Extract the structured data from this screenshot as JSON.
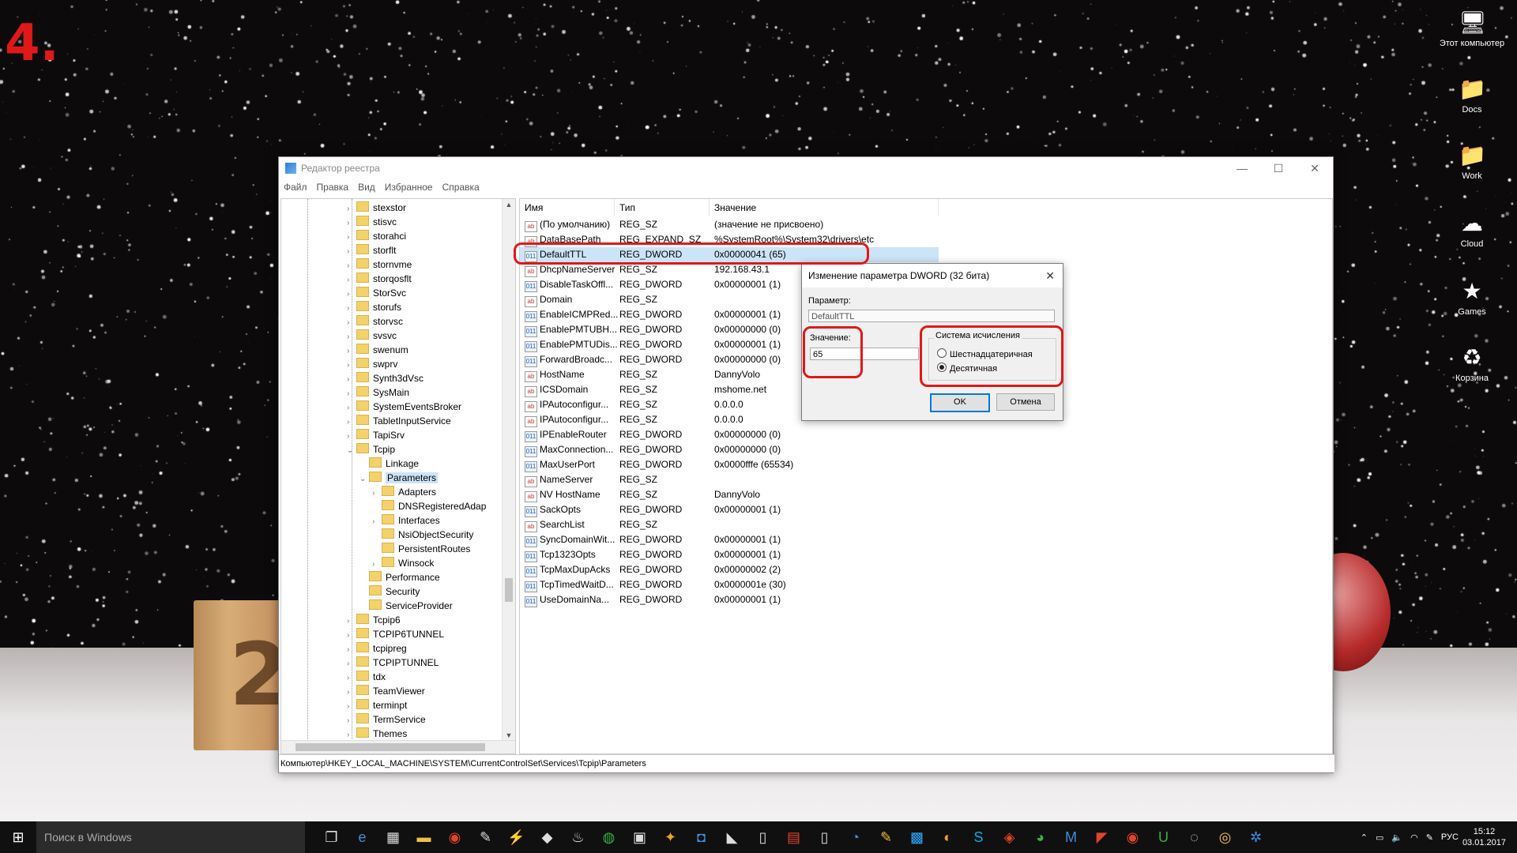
{
  "step_label": "4.",
  "desktop_icons": [
    {
      "label": "Этот компьютер",
      "icon": "monitor-icon"
    },
    {
      "label": "Docs",
      "icon": "folder-icon"
    },
    {
      "label": "Work",
      "icon": "folder-icon"
    },
    {
      "label": "Cloud",
      "icon": "cloud-icon"
    },
    {
      "label": "Games",
      "icon": "star-icon"
    },
    {
      "label": "Корзина",
      "icon": "recycle-bin-icon"
    }
  ],
  "window": {
    "title": "Редактор реестра",
    "menu": [
      "Файл",
      "Правка",
      "Вид",
      "Избранное",
      "Справка"
    ],
    "tree": [
      {
        "label": "stexstor",
        "level": 0,
        "expander": ">"
      },
      {
        "label": "stisvc",
        "level": 0,
        "expander": ">"
      },
      {
        "label": "storahci",
        "level": 0,
        "expander": ">"
      },
      {
        "label": "storflt",
        "level": 0,
        "expander": ">"
      },
      {
        "label": "stornvme",
        "level": 0,
        "expander": ">"
      },
      {
        "label": "storqosflt",
        "level": 0,
        "expander": ">"
      },
      {
        "label": "StorSvc",
        "level": 0,
        "expander": ">"
      },
      {
        "label": "storufs",
        "level": 0,
        "expander": ">"
      },
      {
        "label": "storvsc",
        "level": 0,
        "expander": ">"
      },
      {
        "label": "svsvc",
        "level": 0,
        "expander": ">"
      },
      {
        "label": "swenum",
        "level": 0,
        "expander": ">"
      },
      {
        "label": "swprv",
        "level": 0,
        "expander": ">"
      },
      {
        "label": "Synth3dVsc",
        "level": 0,
        "expander": ">"
      },
      {
        "label": "SysMain",
        "level": 0,
        "expander": ">"
      },
      {
        "label": "SystemEventsBroker",
        "level": 0,
        "expander": ">"
      },
      {
        "label": "TabletInputService",
        "level": 0,
        "expander": ">"
      },
      {
        "label": "TapiSrv",
        "level": 0,
        "expander": ">"
      },
      {
        "label": "Tcpip",
        "level": 0,
        "expander": "v"
      },
      {
        "label": "Linkage",
        "level": 1,
        "expander": ""
      },
      {
        "label": "Parameters",
        "level": 1,
        "expander": "v",
        "selected": true
      },
      {
        "label": "Adapters",
        "level": 2,
        "expander": ">"
      },
      {
        "label": "DNSRegisteredAdap",
        "level": 2,
        "expander": ""
      },
      {
        "label": "Interfaces",
        "level": 2,
        "expander": ">"
      },
      {
        "label": "NsiObjectSecurity",
        "level": 2,
        "expander": ""
      },
      {
        "label": "PersistentRoutes",
        "level": 2,
        "expander": ""
      },
      {
        "label": "Winsock",
        "level": 2,
        "expander": ">"
      },
      {
        "label": "Performance",
        "level": 1,
        "expander": ""
      },
      {
        "label": "Security",
        "level": 1,
        "expander": ""
      },
      {
        "label": "ServiceProvider",
        "level": 1,
        "expander": ""
      },
      {
        "label": "Tcpip6",
        "level": 0,
        "expander": ">"
      },
      {
        "label": "TCPIP6TUNNEL",
        "level": 0,
        "expander": ">"
      },
      {
        "label": "tcpipreg",
        "level": 0,
        "expander": ">"
      },
      {
        "label": "TCPIPTUNNEL",
        "level": 0,
        "expander": ">"
      },
      {
        "label": "tdx",
        "level": 0,
        "expander": ">"
      },
      {
        "label": "TeamViewer",
        "level": 0,
        "expander": ">"
      },
      {
        "label": "terminpt",
        "level": 0,
        "expander": ">"
      },
      {
        "label": "TermService",
        "level": 0,
        "expander": ">"
      },
      {
        "label": "Themes",
        "level": 0,
        "expander": ">"
      }
    ],
    "columns": [
      "Имя",
      "Тип",
      "Значение"
    ],
    "values": [
      {
        "name": "(По умолчанию)",
        "type": "REG_SZ",
        "data": "(значение не присвоено)",
        "kind": "str"
      },
      {
        "name": "DataBasePath",
        "type": "REG_EXPAND_SZ",
        "data": "%SystemRoot%\\System32\\drivers\\etc",
        "kind": "str"
      },
      {
        "name": "DefaultTTL",
        "type": "REG_DWORD",
        "data": "0x00000041 (65)",
        "kind": "bin",
        "selected": true
      },
      {
        "name": "DhcpNameServer",
        "type": "REG_SZ",
        "data": "192.168.43.1",
        "kind": "str"
      },
      {
        "name": "DisableTaskOffl...",
        "type": "REG_DWORD",
        "data": "0x00000001 (1)",
        "kind": "bin"
      },
      {
        "name": "Domain",
        "type": "REG_SZ",
        "data": "",
        "kind": "str"
      },
      {
        "name": "EnableICMPRed...",
        "type": "REG_DWORD",
        "data": "0x00000001 (1)",
        "kind": "bin"
      },
      {
        "name": "EnablePMTUBH...",
        "type": "REG_DWORD",
        "data": "0x00000000 (0)",
        "kind": "bin"
      },
      {
        "name": "EnablePMTUDis...",
        "type": "REG_DWORD",
        "data": "0x00000001 (1)",
        "kind": "bin"
      },
      {
        "name": "ForwardBroadc...",
        "type": "REG_DWORD",
        "data": "0x00000000 (0)",
        "kind": "bin"
      },
      {
        "name": "HostName",
        "type": "REG_SZ",
        "data": "DannyVolo",
        "kind": "str"
      },
      {
        "name": "ICSDomain",
        "type": "REG_SZ",
        "data": "mshome.net",
        "kind": "str"
      },
      {
        "name": "IPAutoconfigur...",
        "type": "REG_SZ",
        "data": "0.0.0.0",
        "kind": "str"
      },
      {
        "name": "IPAutoconfigur...",
        "type": "REG_SZ",
        "data": "0.0.0.0",
        "kind": "str"
      },
      {
        "name": "IPEnableRouter",
        "type": "REG_DWORD",
        "data": "0x00000000 (0)",
        "kind": "bin"
      },
      {
        "name": "MaxConnection...",
        "type": "REG_DWORD",
        "data": "0x00000000 (0)",
        "kind": "bin"
      },
      {
        "name": "MaxUserPort",
        "type": "REG_DWORD",
        "data": "0x0000fffe (65534)",
        "kind": "bin"
      },
      {
        "name": "NameServer",
        "type": "REG_SZ",
        "data": "",
        "kind": "str"
      },
      {
        "name": "NV HostName",
        "type": "REG_SZ",
        "data": "DannyVolo",
        "kind": "str"
      },
      {
        "name": "SackOpts",
        "type": "REG_DWORD",
        "data": "0x00000001 (1)",
        "kind": "bin"
      },
      {
        "name": "SearchList",
        "type": "REG_SZ",
        "data": "",
        "kind": "str"
      },
      {
        "name": "SyncDomainWit...",
        "type": "REG_DWORD",
        "data": "0x00000001 (1)",
        "kind": "bin"
      },
      {
        "name": "Tcp1323Opts",
        "type": "REG_DWORD",
        "data": "0x00000001 (1)",
        "kind": "bin"
      },
      {
        "name": "TcpMaxDupAcks",
        "type": "REG_DWORD",
        "data": "0x00000002 (2)",
        "kind": "bin"
      },
      {
        "name": "TcpTimedWaitD...",
        "type": "REG_DWORD",
        "data": "0x0000001e (30)",
        "kind": "bin"
      },
      {
        "name": "UseDomainNa...",
        "type": "REG_DWORD",
        "data": "0x00000001 (1)",
        "kind": "bin"
      }
    ],
    "status_path": "Компьютер\\HKEY_LOCAL_MACHINE\\SYSTEM\\CurrentControlSet\\Services\\Tcpip\\Parameters"
  },
  "dialog": {
    "title": "Изменение параметра DWORD (32 бита)",
    "param_label": "Параметр:",
    "param_value": "DefaultTTL",
    "value_label": "Значение:",
    "value": "65",
    "base_group_label": "Система исчисления",
    "radio_hex": "Шестнадцатеричная",
    "radio_dec": "Десятичная",
    "selected_base": "dec",
    "ok": "OK",
    "cancel": "Отмена"
  },
  "taskbar": {
    "search_placeholder": "Поиск в Windows",
    "language": "РУС",
    "time": "15:12",
    "date": "03.01.2017"
  },
  "colors": {
    "highlight": "#e01818",
    "selection": "#cce4f7",
    "accent": "#0078d7"
  }
}
